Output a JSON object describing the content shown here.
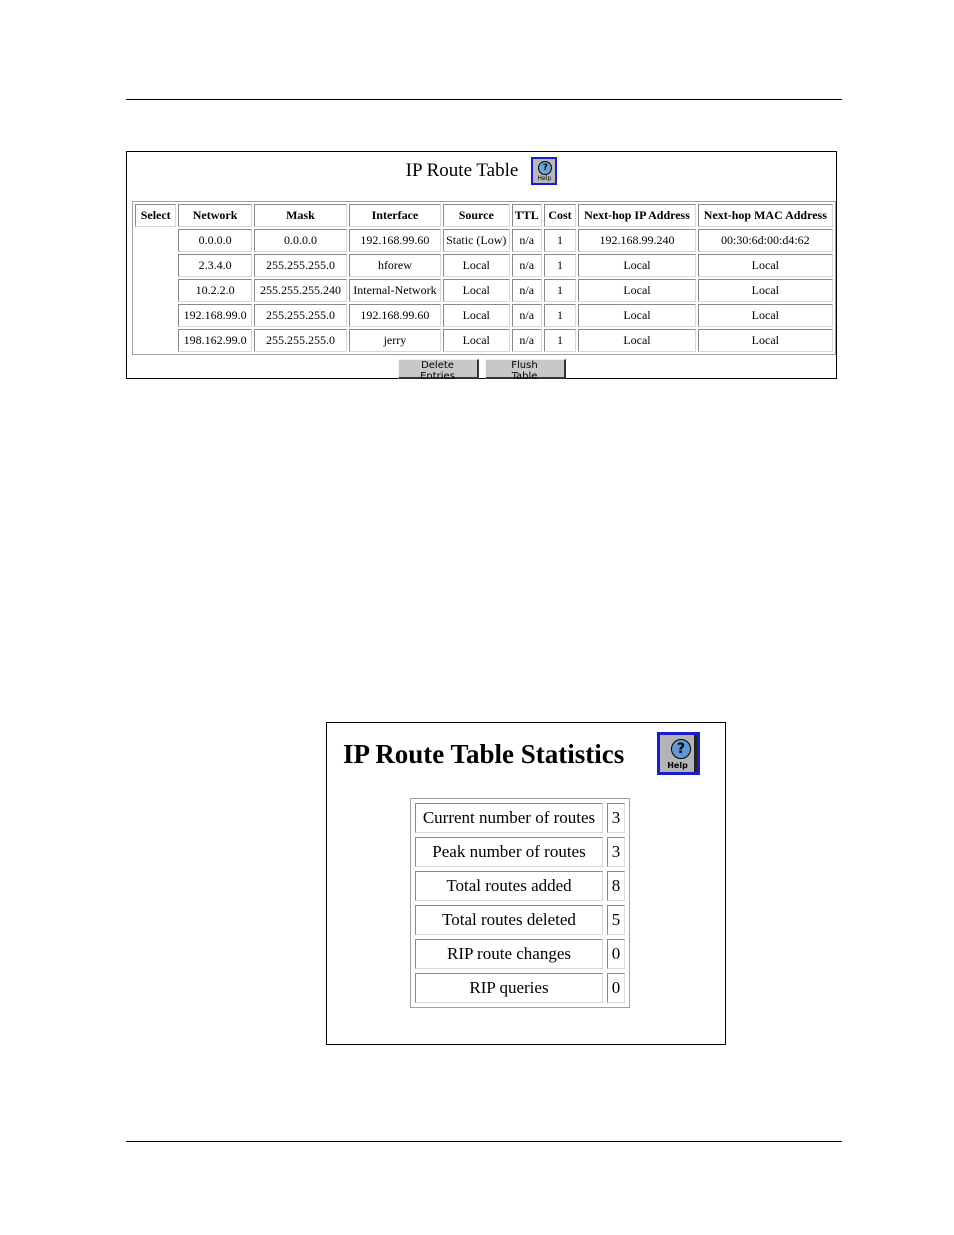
{
  "route_table": {
    "title": "IP Route Table",
    "help_label": "Help",
    "columns": [
      "Select",
      "Network",
      "Mask",
      "Interface",
      "Source",
      "TTL",
      "Cost",
      "Next-hop IP Address",
      "Next-hop MAC Address"
    ],
    "rows": [
      {
        "network": "0.0.0.0",
        "mask": "0.0.0.0",
        "interface": "192.168.99.60",
        "source": "Static (Low)",
        "ttl": "n/a",
        "cost": "1",
        "nexthop_ip": "192.168.99.240",
        "nexthop_mac": "00:30:6d:00:d4:62"
      },
      {
        "network": "2.3.4.0",
        "mask": "255.255.255.0",
        "interface": "hforew",
        "source": "Local",
        "ttl": "n/a",
        "cost": "1",
        "nexthop_ip": "Local",
        "nexthop_mac": "Local"
      },
      {
        "network": "10.2.2.0",
        "mask": "255.255.255.240",
        "interface": "Internal-Network",
        "source": "Local",
        "ttl": "n/a",
        "cost": "1",
        "nexthop_ip": "Local",
        "nexthop_mac": "Local"
      },
      {
        "network": "192.168.99.0",
        "mask": "255.255.255.0",
        "interface": "192.168.99.60",
        "source": "Local",
        "ttl": "n/a",
        "cost": "1",
        "nexthop_ip": "Local",
        "nexthop_mac": "Local"
      },
      {
        "network": "198.162.99.0",
        "mask": "255.255.255.0",
        "interface": "jerry",
        "source": "Local",
        "ttl": "n/a",
        "cost": "1",
        "nexthop_ip": "Local",
        "nexthop_mac": "Local"
      }
    ],
    "buttons": {
      "delete": "Delete Entries",
      "flush": "Flush Table"
    }
  },
  "stats": {
    "title": "IP Route Table Statistics",
    "help_label": "Help",
    "rows": [
      {
        "label": "Current number of routes",
        "value": "3"
      },
      {
        "label": "Peak number of routes",
        "value": "3"
      },
      {
        "label": "Total routes added",
        "value": "8"
      },
      {
        "label": "Total routes deleted",
        "value": "5"
      },
      {
        "label": "RIP route changes",
        "value": "0"
      },
      {
        "label": "RIP queries",
        "value": "0"
      }
    ]
  },
  "icons": {
    "help": "help-question-icon"
  },
  "colors": {
    "help_border": "#1b1bd0",
    "button_face": "#c8c8c8"
  }
}
